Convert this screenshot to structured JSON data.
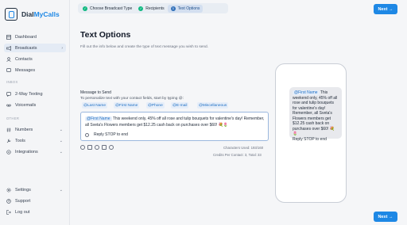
{
  "app": {
    "logo_dial": "Dial",
    "logo_mycalls": "MyCalls"
  },
  "sidebar": {
    "items": [
      {
        "label": "Dashboard"
      },
      {
        "label": "Broadcasts"
      },
      {
        "label": "Contacts"
      },
      {
        "label": "Messages"
      },
      {
        "label": "2-Way Texting"
      },
      {
        "label": "Voicemails"
      },
      {
        "label": "Numbers"
      },
      {
        "label": "Tools"
      },
      {
        "label": "Integrations"
      },
      {
        "label": "Settings"
      },
      {
        "label": "Support"
      },
      {
        "label": "Log out"
      }
    ],
    "sections": {
      "inbox": "INBOX",
      "other": "OTHER"
    }
  },
  "steps": [
    {
      "label": "Choose Broadcast Type",
      "status": "done"
    },
    {
      "label": "Recipients",
      "status": "done"
    },
    {
      "label": "Text Options",
      "status": "current",
      "number": "3"
    }
  ],
  "buttons": {
    "next": "Next"
  },
  "page": {
    "title": "Text Options",
    "subtitle": "Fill out the info below and create the type of text message you wish to send."
  },
  "composer": {
    "label": "Message to Send",
    "hint": "To personalize text with your contact fields, start by typing @:",
    "chips": [
      "@Last Name",
      "@First Name",
      "@Phone",
      "@E-mail",
      "@Miscellaneous"
    ],
    "tag": "@First Name",
    "message": "This weekend only, 45% off all rose and tulip bouquets for valentine's day! Remember, all Sveta's Flowers members get $12.25 cash back on purchases over $60! 💐🌷",
    "reply_stop": "Reply STOP to end",
    "characters_used": "Characters Used: 193/160",
    "credits": "Credits Per Contact: 3, Total: 33"
  },
  "preview": {
    "tag": "@First Name",
    "text": "This weekend only, 45% off all rose and tulip bouquets for valentine's day! Remember, all Sveta's Flowers members get $12.25 cash back on purchases over $60! 💐🌷",
    "reply_stop": "Reply STOP to end"
  },
  "colors": {
    "accent": "#1e88e5",
    "success": "#10b981",
    "tag_bg": "#e6eef9"
  }
}
